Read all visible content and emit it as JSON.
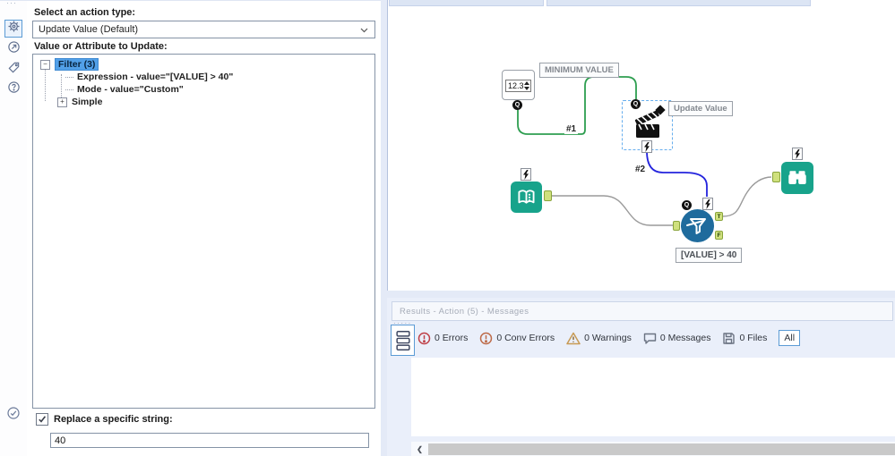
{
  "sidebar": {
    "icons": [
      "settings-gear",
      "navigation",
      "tag",
      "help",
      "check"
    ]
  },
  "config": {
    "action_type_label": "Select an action type:",
    "action_type_value": "Update Value (Default)",
    "attribute_label": "Value or Attribute to Update:",
    "tree": {
      "root": "Filter (3)",
      "items": [
        "Expression - value=\"[VALUE] > 40\"",
        "Mode - value=\"Custom\"",
        "Simple"
      ]
    },
    "replace_checkbox_label": "Replace a specific string:",
    "replace_value": "40"
  },
  "canvas": {
    "numeric_value": "12.3",
    "labels": {
      "minimum_value": "MINIMUM VALUE",
      "update_value": "Update Value",
      "filter_expression": "[VALUE] > 40"
    },
    "connections": {
      "first": "#1",
      "second": "#2"
    },
    "ports": {
      "q": "Q",
      "t": "T",
      "f": "F"
    }
  },
  "results": {
    "title": "Results - Action (5) - Messages",
    "counters": [
      {
        "icon": "error-circle",
        "label": "0 Errors"
      },
      {
        "icon": "conv-error-circle",
        "label": "0 Conv Errors"
      },
      {
        "icon": "warning-triangle",
        "label": "0 Warnings"
      },
      {
        "icon": "message-bubble",
        "label": "0 Messages"
      },
      {
        "icon": "files",
        "label": "0 Files"
      }
    ],
    "filter_all_label": "All",
    "scroll_left_arrow": "❮"
  },
  "colors": {
    "teal": "#18a38b",
    "filter_blue": "#1f6b9d",
    "wire_green": "#2e9e50",
    "wire_blue": "#2424dd",
    "selection_blue": "#66aeee",
    "anchor_green": "#cfe07d",
    "error_red": "#bf4048",
    "conv_error_orange": "#bd6a48",
    "warning_orange": "#c79a54"
  }
}
